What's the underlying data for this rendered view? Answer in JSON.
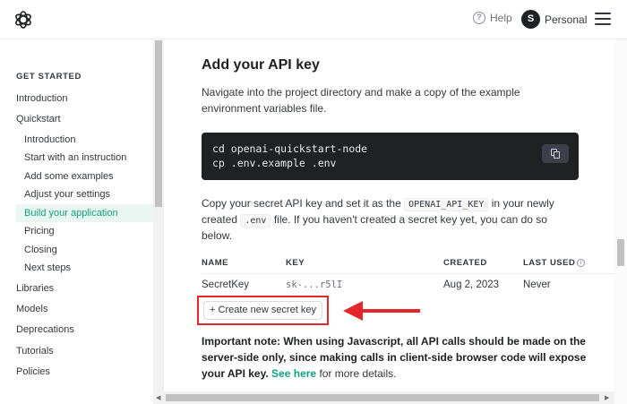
{
  "header": {
    "help_label": "Help",
    "avatar_initial": "S",
    "account_label": "Personal"
  },
  "sidebar": {
    "section_title": "GET STARTED",
    "items": [
      {
        "label": "Introduction",
        "level": "top"
      },
      {
        "label": "Quickstart",
        "level": "top"
      },
      {
        "label": "Introduction",
        "level": "sub"
      },
      {
        "label": "Start with an instruction",
        "level": "sub"
      },
      {
        "label": "Add some examples",
        "level": "sub"
      },
      {
        "label": "Adjust your settings",
        "level": "sub"
      },
      {
        "label": "Build your application",
        "level": "sub",
        "active": true
      },
      {
        "label": "Pricing",
        "level": "sub"
      },
      {
        "label": "Closing",
        "level": "sub"
      },
      {
        "label": "Next steps",
        "level": "sub"
      },
      {
        "label": "Libraries",
        "level": "top"
      },
      {
        "label": "Models",
        "level": "top"
      },
      {
        "label": "Deprecations",
        "level": "top"
      },
      {
        "label": "Tutorials",
        "level": "top"
      },
      {
        "label": "Policies",
        "level": "top"
      }
    ]
  },
  "main": {
    "heading": "Add your API key",
    "intro_line1": "Navigate into the project directory and make a copy of the example",
    "intro_line2": "environment variables file.",
    "code_line1": "cd openai-quickstart-node",
    "code_line2": "cp .env.example .env",
    "para_part1": "Copy your secret API key and set it as the",
    "para_code1": "OPENAI_API_KEY",
    "para_part2": "in your newly",
    "para_part3": "created",
    "para_code2": ".env",
    "para_part4": "file. If you haven't created a secret key yet, you can do so",
    "para_part5": "below.",
    "table": {
      "headers": {
        "name": "NAME",
        "key": "KEY",
        "created": "CREATED",
        "last_used": "LAST USED"
      },
      "row": {
        "name": "SecretKey",
        "key": "sk-...r5lI",
        "created": "Aug 2, 2023",
        "last_used": "Never"
      }
    },
    "create_button_label": "+ Create new secret key",
    "note_bold": "Important note: When using Javascript, all API calls should be made on the server-side only, since making calls in client-side browser code will expose your API key.",
    "note_link": "See here",
    "note_rest": "for more details."
  },
  "colors": {
    "accent": "#10a37f",
    "highlight_border": "#e5262b",
    "code_bg": "#202123"
  }
}
